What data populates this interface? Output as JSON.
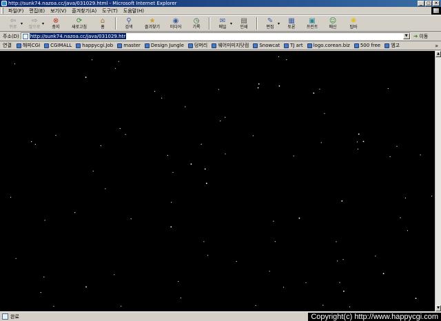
{
  "window": {
    "title": "http://sunk74.nazoa.cc/java/031029.html - Microsoft Internet Explorer"
  },
  "menu": [
    "파일(F)",
    "편집(E)",
    "보기(V)",
    "즐겨찾기(A)",
    "도구(T)",
    "도움말(H)"
  ],
  "toolbar": {
    "back": "뒤로",
    "forward": "앞으로",
    "stop": "중지",
    "refresh": "새로고침",
    "home": "홈",
    "search": "검색",
    "favorites": "즐겨찾기",
    "media": "미디어",
    "history": "기록",
    "mail": "메일",
    "print": "인쇄",
    "edit": "편집",
    "discuss": "토론",
    "print_ext": "프린트",
    "messenger": "메신",
    "tips": "팁바"
  },
  "address": {
    "label": "주소(D)",
    "value": "http://sunk74.nazoa.cc/java/031029.html",
    "go": "이동"
  },
  "links": {
    "label": "연결",
    "items": [
      "해피CGI",
      "CGIMALL",
      "happycgi.Job",
      "master",
      "Design Jungle",
      "덩머리",
      "웨어미미지닷컴",
      "Snowcat",
      "TJ art",
      "logo.corean.biz",
      "500 free",
      "엠고"
    ]
  },
  "status": {
    "text": "완료",
    "copyright": "Copyright(c) http://www.happycgi.com"
  },
  "colors": {
    "title_bar": "#0a246a",
    "chrome": "#d4d0c8",
    "page_background": "#000000",
    "star": "#ffffff"
  },
  "icons": [
    "ie-icon",
    "back-icon",
    "forward-icon",
    "stop-icon",
    "refresh-icon",
    "home-icon",
    "search-icon",
    "favorites-icon",
    "media-icon",
    "history-icon",
    "mail-icon",
    "print-icon",
    "edit-icon",
    "discuss-icon",
    "go-arrow-icon",
    "page-icon"
  ]
}
